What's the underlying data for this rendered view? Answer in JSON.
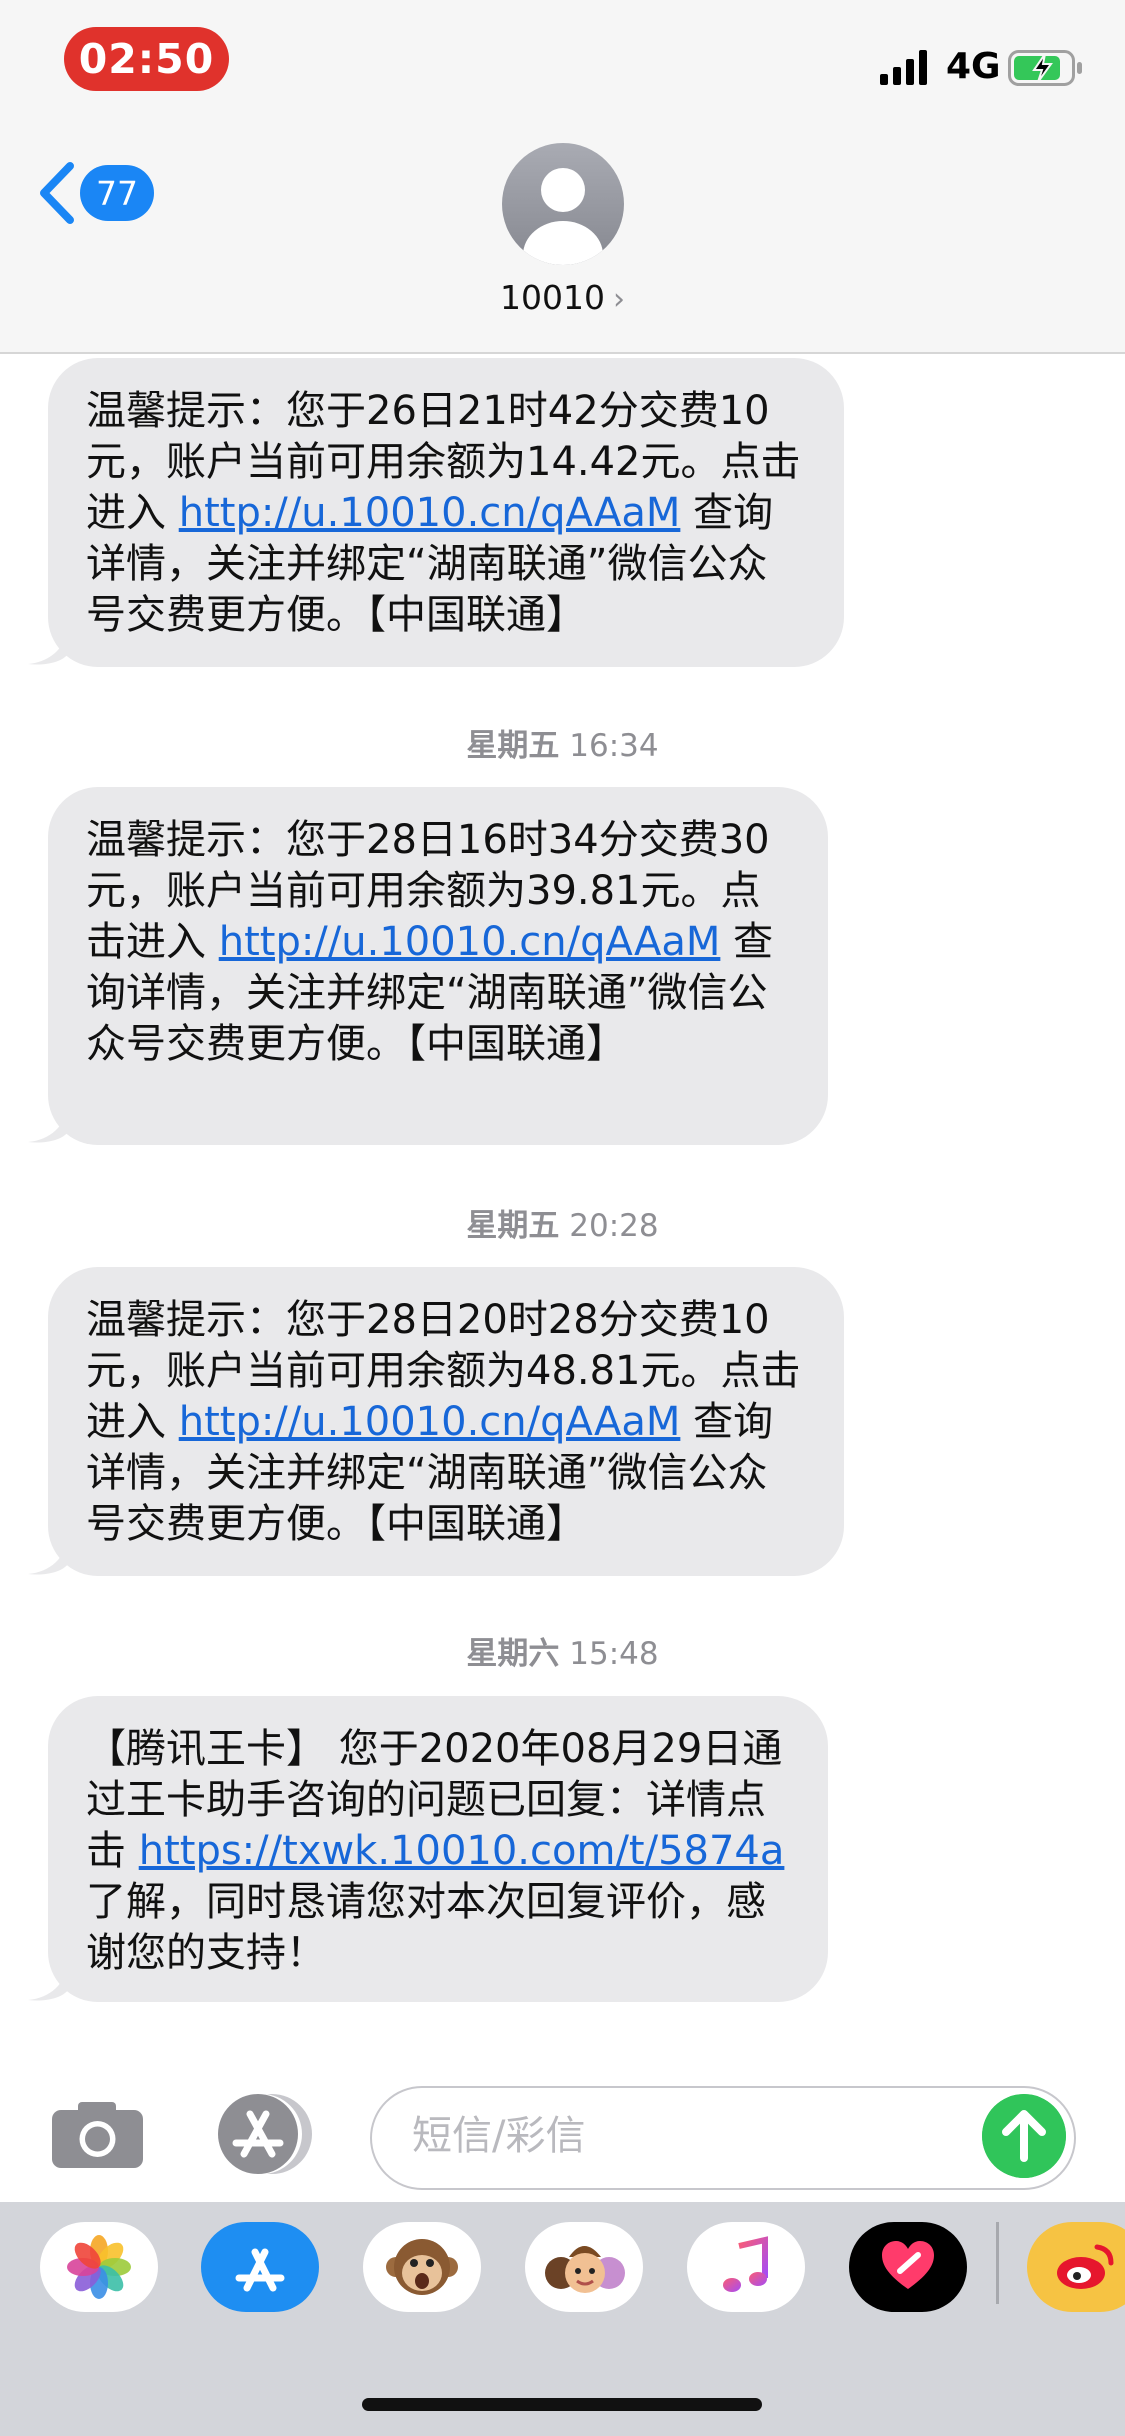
{
  "status_bar": {
    "time": "02:50",
    "network": "4G"
  },
  "header": {
    "back_badge": "77",
    "contact_name": "10010",
    "contact_chevron": "›"
  },
  "messages": [
    {
      "text_before_link": "温馨提示：您于26日21时42分交费10元，账户当前可用余额为14.42元。点击进入 ",
      "link": "http://u.10010.cn/qAAaM",
      "text_after_link": " 查询详情，关注并绑定“湖南联通”微信公众号交费更方便。【中国联通】"
    },
    {
      "timestamp_day": "星期五",
      "timestamp_time": "16:34",
      "text_before_link": "温馨提示：您于28日16时34分交费30元，账户当前可用余额为39.81元。点击进入 ",
      "link": "http://u.10010.cn/qAAaM",
      "text_after_link": " 查询详情，关注并绑定“湖南联通”微信公众号交费更方便。【中国联通】"
    },
    {
      "timestamp_day": "星期五",
      "timestamp_time": "20:28",
      "text_before_link": "温馨提示：您于28日20时28分交费10元，账户当前可用余额为48.81元。点击进入 ",
      "link": "http://u.10010.cn/qAAaM",
      "text_after_link": " 查询详情，关注并绑定“湖南联通”微信公众号交费更方便。【中国联通】"
    },
    {
      "timestamp_day": "星期六",
      "timestamp_time": "15:48",
      "text_before_link": "【腾讯王卡】 您于2020年08月29日通过王卡助手咨询的问题已回复：详情点击 ",
      "link": "https://txwk.10010.com/t/5874a",
      "text_after_link": " 了解，同时恳请您对本次回复评价，感谢您的支持！"
    }
  ],
  "input": {
    "placeholder": "短信/彩信"
  },
  "app_drawer": [
    {
      "icon": "photos-icon"
    },
    {
      "icon": "app-store-icon"
    },
    {
      "icon": "animoji-icon"
    },
    {
      "icon": "memoji-icon"
    },
    {
      "icon": "music-icon"
    },
    {
      "icon": "digital-touch-icon"
    },
    {
      "icon": "weibo-icon"
    }
  ],
  "colors": {
    "status_pill": "#e0322c",
    "badge": "#1a86f5",
    "bubble": "#e9e9eb",
    "link": "#1767d8",
    "send": "#30c55a"
  }
}
